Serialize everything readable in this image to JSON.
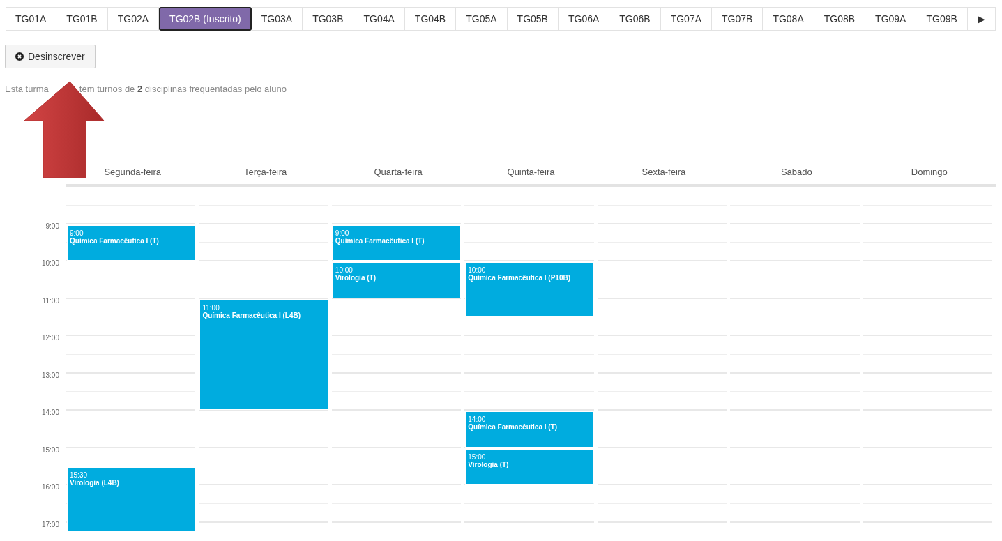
{
  "tabs": [
    {
      "label": "TG01A",
      "selected": false
    },
    {
      "label": "TG01B",
      "selected": false
    },
    {
      "label": "TG02A",
      "selected": false
    },
    {
      "label": "TG02B (Inscrito)",
      "selected": true
    },
    {
      "label": "TG03A",
      "selected": false
    },
    {
      "label": "TG03B",
      "selected": false
    },
    {
      "label": "TG04A",
      "selected": false
    },
    {
      "label": "TG04B",
      "selected": false
    },
    {
      "label": "TG05A",
      "selected": false
    },
    {
      "label": "TG05B",
      "selected": false
    },
    {
      "label": "TG06A",
      "selected": false
    },
    {
      "label": "TG06B",
      "selected": false
    },
    {
      "label": "TG07A",
      "selected": false
    },
    {
      "label": "TG07B",
      "selected": false
    },
    {
      "label": "TG08A",
      "selected": false
    },
    {
      "label": "TG08B",
      "selected": false
    },
    {
      "label": "TG09A",
      "selected": false
    },
    {
      "label": "TG09B",
      "selected": false
    },
    {
      "label": "▶",
      "selected": false
    }
  ],
  "unenroll_button": {
    "label": "Desinscrever"
  },
  "info_text": {
    "before_arrow": "Esta turma",
    "after_arrow": "tém turnos de **2** disciplinas frequentadas pelo aluno"
  },
  "calendar": {
    "time_labels": [
      "9:00",
      "10:00",
      "11:00",
      "12:00",
      "13:00",
      "14:00",
      "15:00",
      "16:00",
      "17:00"
    ],
    "days": [
      {
        "name": "Segunda-feira",
        "events": [
          {
            "time": "9:00",
            "kind": "hour",
            "title": "Química Farmacêutica I (T)"
          },
          {
            "time": "15:30",
            "kind": "overflow",
            "title": "Virologia (L4B)"
          }
        ]
      },
      {
        "name": "Terça-feira",
        "events": [
          {
            "time": "11:00",
            "kind": "triple",
            "title": "Química Farmacêutica I (L4B)"
          }
        ]
      },
      {
        "name": "Quarta-feira",
        "events": [
          {
            "time": "9:00",
            "kind": "hour",
            "title": "Química Farmacêutica I (T)"
          },
          {
            "time": "10:00",
            "kind": "hour",
            "title": "Virologia (T)"
          }
        ]
      },
      {
        "name": "Quinta-feira",
        "events": [
          {
            "time": "10:00",
            "kind": "ninety",
            "title": "Química Farmacêutica I (P10B)"
          },
          {
            "time": "14:00",
            "kind": "hour",
            "title": "Química Farmacêutica I (T)"
          },
          {
            "time": "15:00",
            "kind": "hour",
            "title": "Virologia (T)"
          }
        ]
      },
      {
        "name": "Sexta-feira"
      },
      {
        "name": "Sábado"
      },
      {
        "name": "Domingo"
      }
    ]
  }
}
